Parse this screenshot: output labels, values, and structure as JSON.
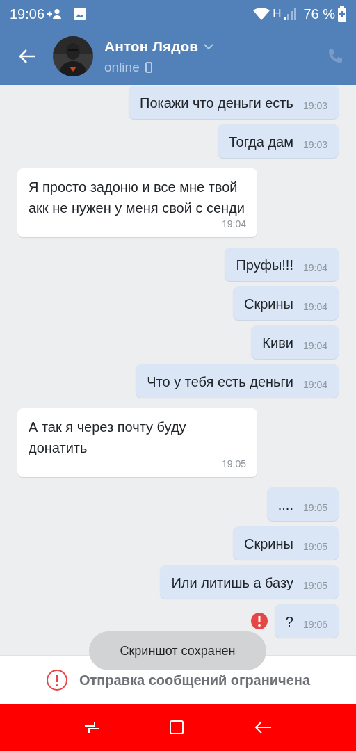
{
  "status_bar": {
    "time": "19:06",
    "network": "H",
    "battery": "76 %"
  },
  "header": {
    "name": "Антон Лядов",
    "presence": "online"
  },
  "messages": [
    {
      "kind": "outgoing",
      "text": "Покажи что деньги есть",
      "time": "19:03",
      "failed": false
    },
    {
      "kind": "outgoing",
      "text": "Тогда дам",
      "time": "19:03",
      "failed": false
    },
    {
      "kind": "incoming",
      "text": "Я просто задоню и все мне твой акк не нужен у меня свой с сенди",
      "time": "19:04",
      "failed": false
    },
    {
      "kind": "outgoing",
      "text": "Пруфы!!!",
      "time": "19:04",
      "failed": false
    },
    {
      "kind": "outgoing",
      "text": "Скрины",
      "time": "19:04",
      "failed": false
    },
    {
      "kind": "outgoing",
      "text": "Киви",
      "time": "19:04",
      "failed": false
    },
    {
      "kind": "outgoing",
      "text": "Что у тебя есть деньги",
      "time": "19:04",
      "failed": false
    },
    {
      "kind": "incoming",
      "text": "А так я через почту буду донатить",
      "time": "19:05",
      "failed": false
    },
    {
      "kind": "outgoing",
      "text": "....",
      "time": "19:05",
      "failed": false
    },
    {
      "kind": "outgoing",
      "text": "Скрины",
      "time": "19:05",
      "failed": false
    },
    {
      "kind": "outgoing",
      "text": "Или литишь а базу",
      "time": "19:05",
      "failed": false
    },
    {
      "kind": "outgoing",
      "text": "?",
      "time": "19:06",
      "failed": true
    }
  ],
  "toast": "Скриншот сохранен",
  "restriction": "Отправка сообщений ограничена"
}
